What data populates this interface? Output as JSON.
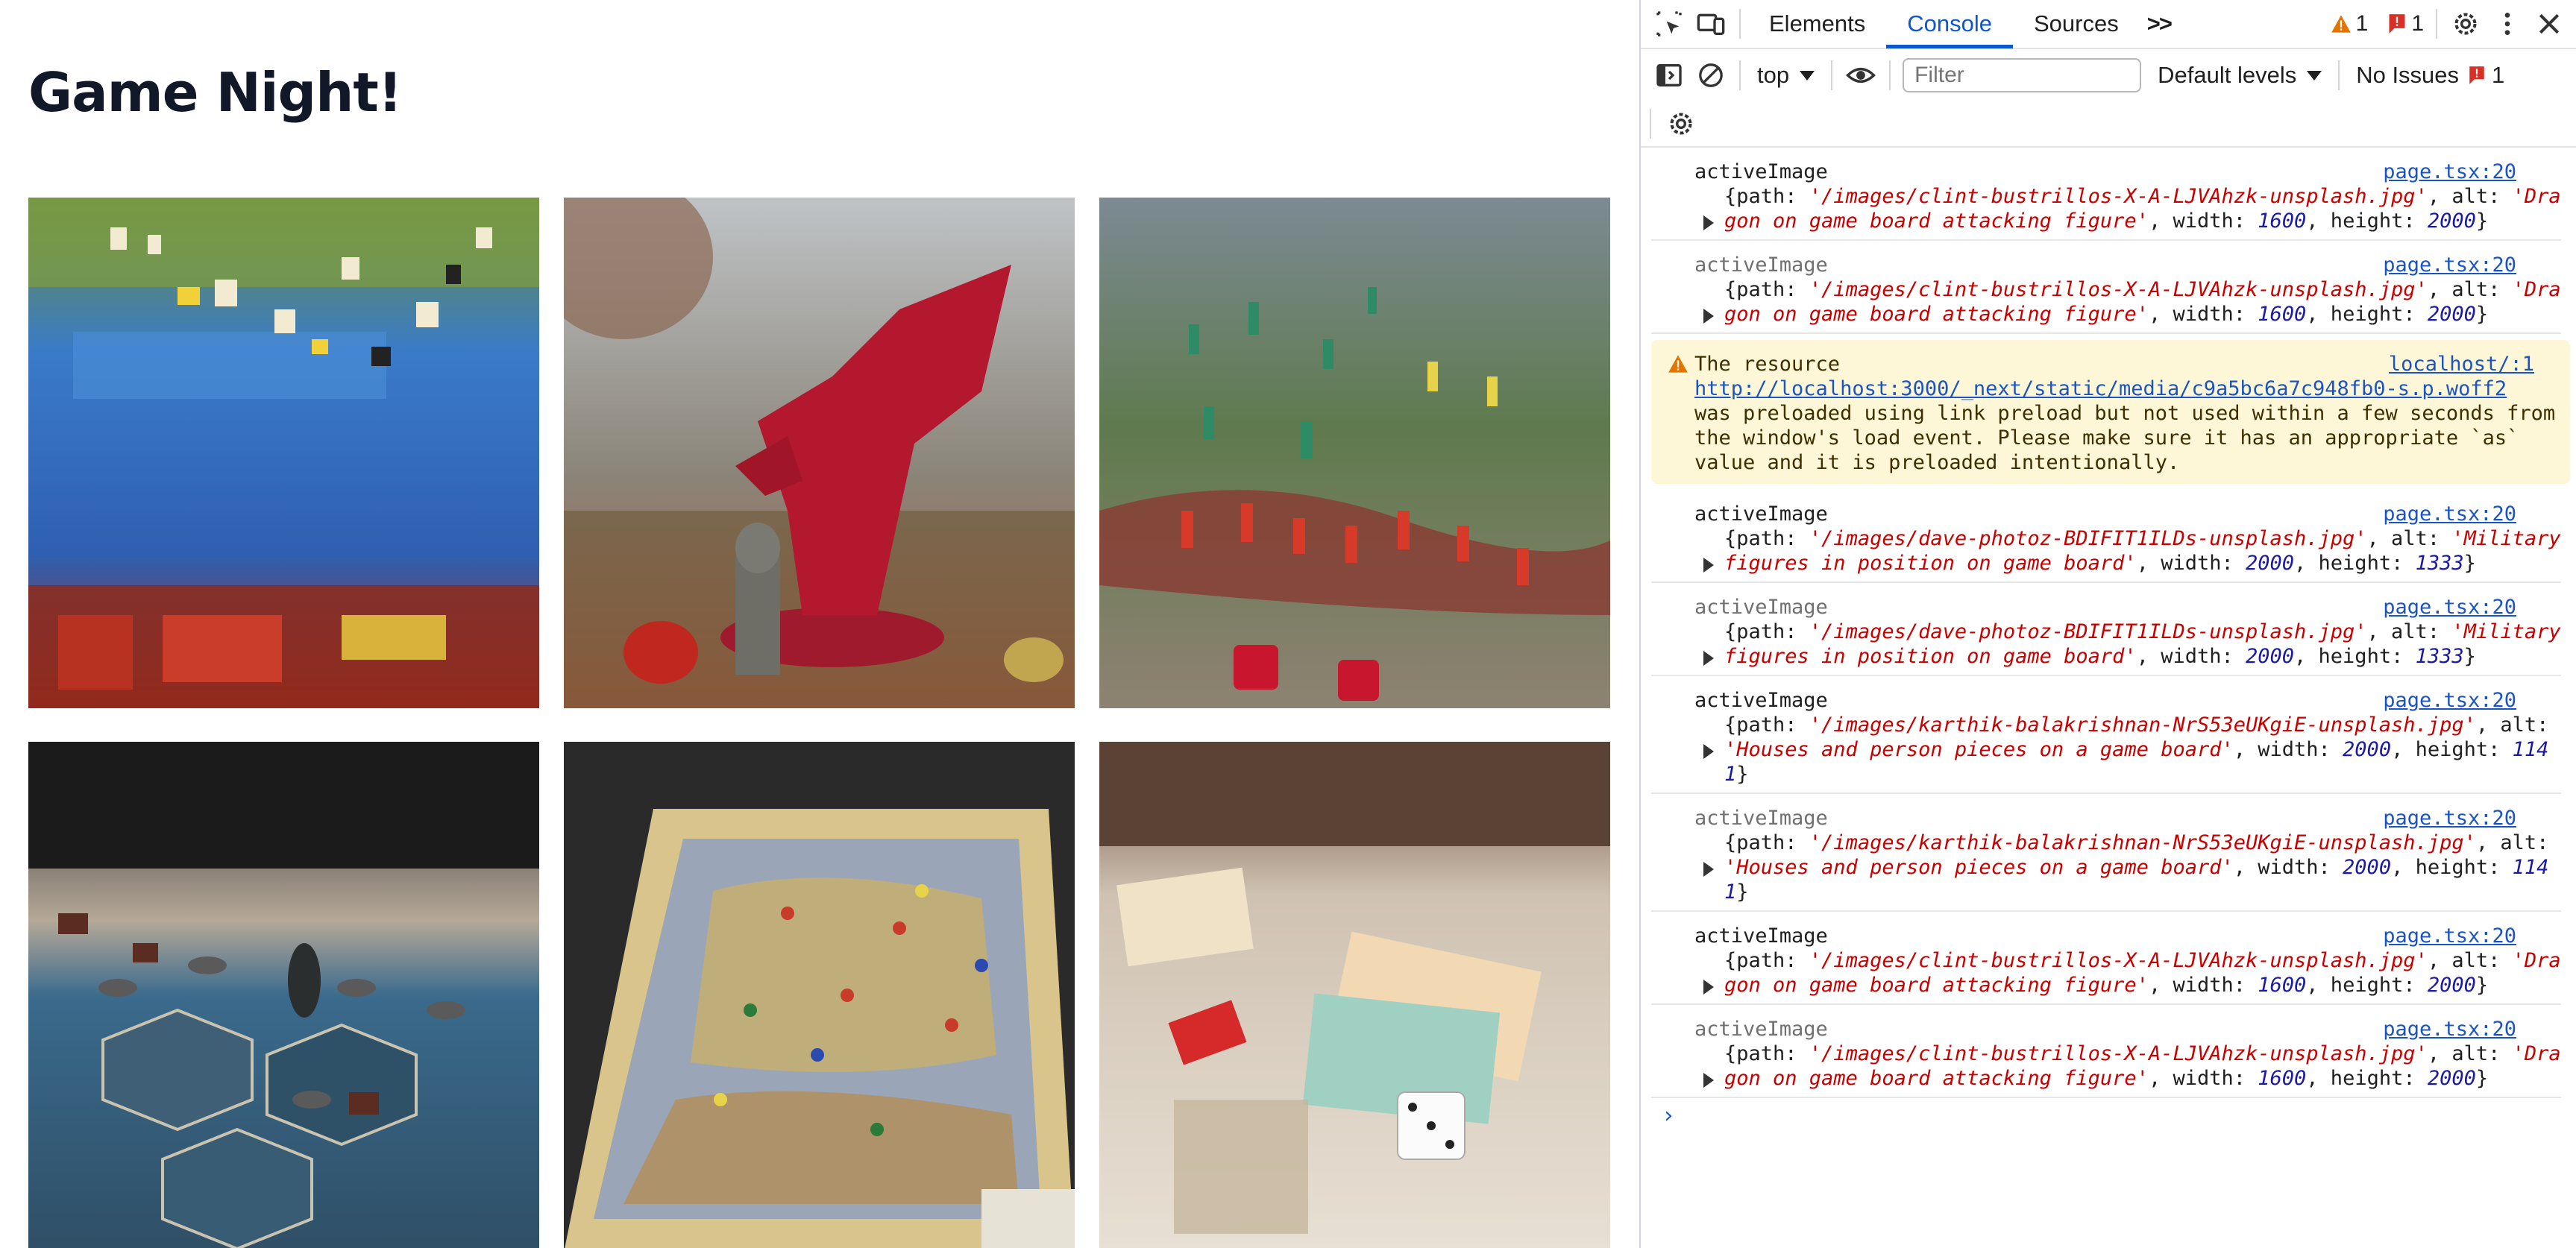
{
  "page": {
    "title": "Game Night!",
    "images": [
      {
        "name": "game-image-1",
        "alt": "Blue game board with wooden pieces"
      },
      {
        "name": "game-image-2",
        "alt": "Dragon on game board attacking figure"
      },
      {
        "name": "game-image-3",
        "alt": "Military figures in position on game board"
      },
      {
        "name": "game-image-4",
        "alt": "Houses and person pieces on a game board"
      },
      {
        "name": "game-image-5",
        "alt": "Map board game with colored pieces"
      },
      {
        "name": "game-image-6",
        "alt": "Board game cards and dice on table"
      }
    ]
  },
  "devtools": {
    "tabs": [
      "Elements",
      "Console",
      "Sources"
    ],
    "active_tab": "Console",
    "more_tabs": ">>",
    "warnings_count": "1",
    "errors_count": "1",
    "context": "top",
    "filter_placeholder": "Filter",
    "levels": "Default levels",
    "issues_label": "No Issues",
    "issues_count": "1",
    "colors": {
      "accent": "#0b57d0",
      "warning_bg": "#fef7d7",
      "string": "#c80000",
      "number": "#1a1aa6",
      "link": "#1a54c4"
    },
    "messages": [
      {
        "label": "activeImage",
        "source": "page.tsx:20",
        "repeat": false,
        "path": "'/images/clint-bustrillos-X-A-LJVAhzk-unsplash.jpg'",
        "alt": "'Dragon on game board attacking figure'",
        "width": "1600",
        "height": "2000"
      },
      {
        "label": "activeImage",
        "source": "page.tsx:20",
        "repeat": true,
        "path": "'/images/clint-bustrillos-X-A-LJVAhzk-unsplash.jpg'",
        "alt": "'Dragon on game board attacking figure'",
        "width": "1600",
        "height": "2000"
      },
      {
        "type": "warning",
        "source": "localhost/:1",
        "text_before": "The resource",
        "link": "http://localhost:3000/_next/static/media/c9a5bc6a7c948fb0-s.p.woff2",
        "text_after": "was preloaded using link preload but not used within a few seconds from the window's load event. Please make sure it has an appropriate `as` value and it is preloaded intentionally."
      },
      {
        "label": "activeImage",
        "source": "page.tsx:20",
        "repeat": false,
        "path": "'/images/dave-photoz-BDIFIT1ILDs-unsplash.jpg'",
        "alt": "'Military figures in position on game board'",
        "width": "2000",
        "height": "1333"
      },
      {
        "label": "activeImage",
        "source": "page.tsx:20",
        "repeat": true,
        "path": "'/images/dave-photoz-BDIFIT1ILDs-unsplash.jpg'",
        "alt": "'Military figures in position on game board'",
        "width": "2000",
        "height": "1333"
      },
      {
        "label": "activeImage",
        "source": "page.tsx:20",
        "repeat": false,
        "path": "'/images/karthik-balakrishnan-NrS53eUKgiE-unsplash.jpg'",
        "alt": "'Houses and person pieces on a game board'",
        "width": "2000",
        "height": "1141"
      },
      {
        "label": "activeImage",
        "source": "page.tsx:20",
        "repeat": true,
        "path": "'/images/karthik-balakrishnan-NrS53eUKgiE-unsplash.jpg'",
        "alt": "'Houses and person pieces on a game board'",
        "width": "2000",
        "height": "1141"
      },
      {
        "label": "activeImage",
        "source": "page.tsx:20",
        "repeat": false,
        "path": "'/images/clint-bustrillos-X-A-LJVAhzk-unsplash.jpg'",
        "alt": "'Dragon on game board attacking figure'",
        "width": "1600",
        "height": "2000"
      },
      {
        "label": "activeImage",
        "source": "page.tsx:20",
        "repeat": true,
        "path": "'/images/clint-bustrillos-X-A-LJVAhzk-unsplash.jpg'",
        "alt": "'Dragon on game board attacking figure'",
        "width": "1600",
        "height": "2000"
      }
    ],
    "prompt": "›"
  }
}
